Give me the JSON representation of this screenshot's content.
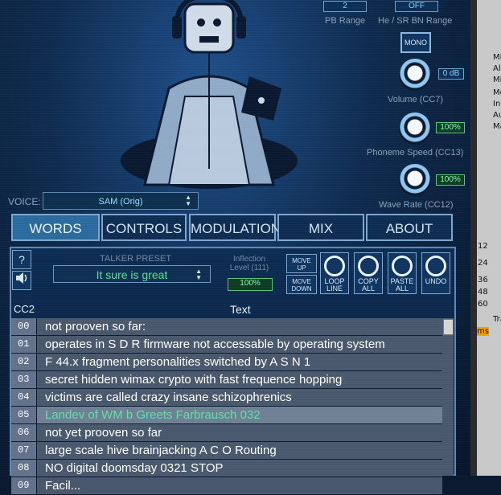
{
  "top_controls": {
    "pb_range_value": "2",
    "pb_range_label": "PB Range",
    "he_sr_value": "OFF",
    "he_sr_label": "He / SR BN Range",
    "mono_label": "MONO"
  },
  "knobs": [
    {
      "label": "Volume (CC7)",
      "value": "0 dB"
    },
    {
      "label": "Phoneme Speed (CC13)",
      "value": "100%"
    },
    {
      "label": "Wave Rate (CC12)",
      "value": "100%"
    }
  ],
  "voice": {
    "label": "VOICE:",
    "value": "SAM (Orig)"
  },
  "tabs": [
    "WORDS",
    "CONTROLS",
    "MODULATION",
    "MIX",
    "ABOUT"
  ],
  "active_tab": "WORDS",
  "talker": {
    "preset_label": "TALKER PRESET",
    "preset_value": "It sure is great",
    "inflection_label": "Inflection Level (111)",
    "inflection_value": "100%"
  },
  "buttons": {
    "help": "?",
    "move_up": "MOVE UP",
    "move_down": "MOVE DOWN",
    "loop_line": "LOOP LINE",
    "copy_all": "COPY ALL",
    "paste_all": "PASTE ALL",
    "undo": "UNDO"
  },
  "table": {
    "col_cc": "CC2",
    "col_text": "Text",
    "rows": [
      {
        "cc": "00",
        "text": "not prooven so far:"
      },
      {
        "cc": "01",
        "text": "operates in S D R firmware  not accessable by operating system"
      },
      {
        "cc": "02",
        "text": "F 44.x fragment personalities switched by  A S N 1"
      },
      {
        "cc": "03",
        "text": "secret hidden wimax crypto with fast frequence hopping"
      },
      {
        "cc": "04",
        "text": "victims are called crazy insane schizophrenics"
      },
      {
        "cc": "05",
        "text": "Landev of WM b Greets Farbrausch 032"
      },
      {
        "cc": "06",
        "text": "not yet prooven so far"
      },
      {
        "cc": "07",
        "text": "large scale hive brainjacking A C O Routing"
      },
      {
        "cc": "08",
        "text": "NO digital doomsday 0321 STOP"
      },
      {
        "cc": "09",
        "text": "Facil..."
      }
    ],
    "selected_index": 5
  },
  "host_strip": {
    "items": [
      "Mi",
      "Al",
      "Mi",
      "Mo",
      "In",
      "Au",
      "Ma",
      "Tra",
      "ms"
    ],
    "numbers": [
      "12",
      "24",
      "36",
      "48",
      "60"
    ]
  }
}
